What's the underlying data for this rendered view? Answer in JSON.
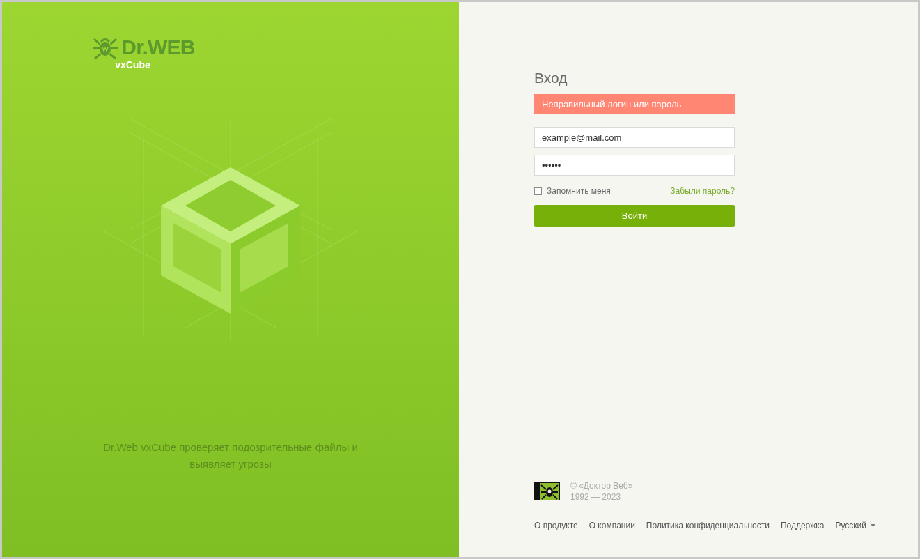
{
  "brand": {
    "logo_text": "Dr.WEB",
    "product": "vxCube"
  },
  "tagline": "Dr.Web vxCube проверяет подозрительные файлы и выявляет угрозы",
  "login": {
    "title": "Вход",
    "error": "Неправильный логин или пароль",
    "email": {
      "value": "example@mail.com"
    },
    "password": {
      "value": "••••••"
    },
    "remember": {
      "label": "Запомнить меня",
      "checked": false
    },
    "forgot": "Забыли пароль?",
    "submit": "Войти"
  },
  "copyright": {
    "owner": "© «Доктор Веб»",
    "years": "1992 — 2023"
  },
  "footer_links": [
    "О продукте",
    "О компании",
    "Политика конфиденциальности",
    "Поддержка"
  ],
  "language": "Русский"
}
